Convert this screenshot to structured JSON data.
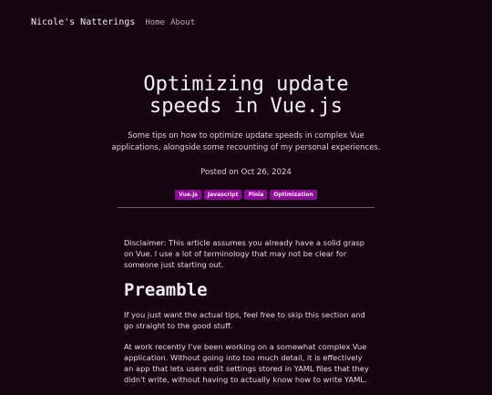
{
  "nav": {
    "site_title": "Nicole's Natterings",
    "links": [
      "Home",
      "About"
    ]
  },
  "post": {
    "title": "Optimizing update speeds in Vue.js",
    "subtitle": "Some tips on how to optimize update speeds in complex Vue applications, alongside some recounting of my personal experiences.",
    "posted": "Posted on Oct 26, 2024",
    "tags": [
      "Vue.js",
      "Javascript",
      "Pinia",
      "Optimization"
    ]
  },
  "content": {
    "disclaimer": "Disclaimer: This article assumes you already have a solid grasp on Vue. I use a lot of terminology that may not be clear for someone just starting out.",
    "preamble_heading": "Preamble",
    "p1": "If you just want the actual tips, feel free to skip this section and go straight to the good stuff.",
    "p2": "At work recently I've been working on a somewhat complex Vue application. Without going into too much detail, it is effectively an app that lets users edit settings stored in YAML files that they didn't write, without having to actually know how to write YAML."
  },
  "colors": {
    "background": "#140511",
    "tag": "#8e0c98"
  }
}
